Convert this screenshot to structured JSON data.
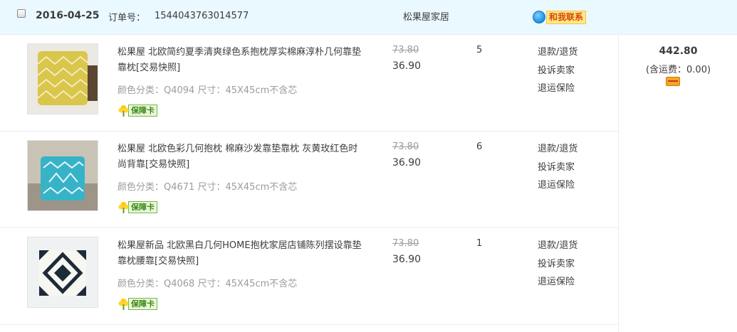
{
  "order": {
    "date": "2016-04-25",
    "number_label": "订单号：",
    "number": "1544043763014577",
    "shop_name": "松果屋家居",
    "contact_label": "和我联系"
  },
  "summary": {
    "total": "442.80",
    "shipping": "(含运费：0.00)"
  },
  "items": [
    {
      "title": "松果屋 北欧简约夏季清爽绿色系抱枕厚实棉麻淳朴几何靠垫靠枕[交易快照]",
      "sku": "颜色分类：Q4094  尺寸：45X45cm不含芯",
      "badge": "保障卡",
      "price_original": "73.80",
      "price_now": "36.90",
      "quantity": "5",
      "actions": [
        "退款/退货",
        "投诉卖家",
        "退运保险"
      ]
    },
    {
      "title": "松果屋 北欧色彩几何抱枕 棉麻沙发靠垫靠枕 灰黄玫红色时尚背靠[交易快照]",
      "sku": "颜色分类：Q4671  尺寸：45X45cm不含芯",
      "badge": "保障卡",
      "price_original": "73.80",
      "price_now": "36.90",
      "quantity": "6",
      "actions": [
        "退款/退货",
        "投诉卖家",
        "退运保险"
      ]
    },
    {
      "title": "松果屋新品 北欧黑白几何HOME抱枕家居店铺陈列摆设靠垫靠枕腰靠[交易快照]",
      "sku": "颜色分类：Q4068  尺寸：45X45cm不含芯",
      "badge": "保障卡",
      "price_original": "73.80",
      "price_now": "36.90",
      "quantity": "1",
      "actions": [
        "退款/退货",
        "投诉卖家",
        "退运保险"
      ]
    }
  ]
}
